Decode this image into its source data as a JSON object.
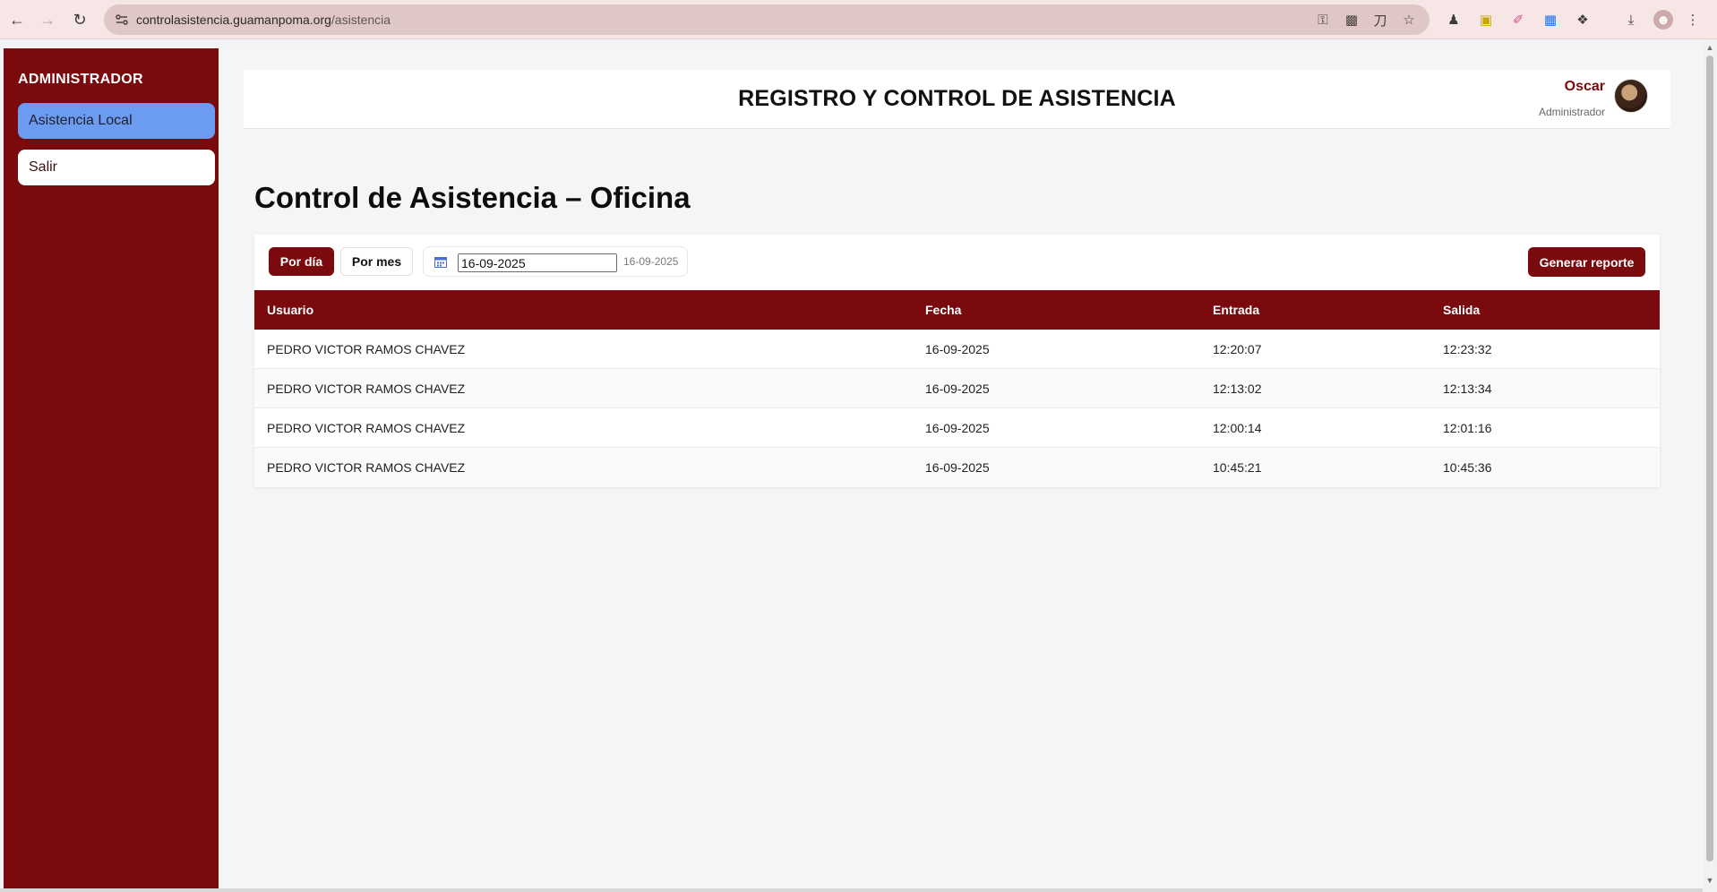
{
  "browser": {
    "url_domain": "controlasistencia.guamanpoma.org",
    "url_path": "/asistencia"
  },
  "sidebar": {
    "title": "ADMINISTRADOR",
    "items": [
      {
        "label": "Asistencia Local",
        "active": true
      },
      {
        "label": "Salir",
        "active": false
      }
    ]
  },
  "header": {
    "title": "REGISTRO Y CONTROL DE ASISTENCIA",
    "user_name": "Oscar",
    "user_role": "Administrador"
  },
  "page": {
    "title": "Control de Asistencia – Oficina"
  },
  "filters": {
    "day_label": "Por día",
    "month_label": "Por mes",
    "date_value": "16-09-2025",
    "date_hint": "16-09-2025",
    "report_label": "Generar reporte"
  },
  "table": {
    "headers": [
      "Usuario",
      "Fecha",
      "Entrada",
      "Salida"
    ],
    "rows": [
      {
        "usuario": "PEDRO VICTOR RAMOS CHAVEZ",
        "fecha": "16-09-2025",
        "entrada": "12:20:07",
        "salida": "12:23:32"
      },
      {
        "usuario": "PEDRO VICTOR RAMOS CHAVEZ",
        "fecha": "16-09-2025",
        "entrada": "12:13:02",
        "salida": "12:13:34"
      },
      {
        "usuario": "PEDRO VICTOR RAMOS CHAVEZ",
        "fecha": "16-09-2025",
        "entrada": "12:00:14",
        "salida": "12:01:16"
      },
      {
        "usuario": "PEDRO VICTOR RAMOS CHAVEZ",
        "fecha": "16-09-2025",
        "entrada": "10:45:21",
        "salida": "10:45:36"
      }
    ]
  },
  "colors": {
    "brand": "#7a0a0d",
    "active_nav": "#6b9cf2"
  },
  "icons": [
    "back-icon",
    "forward-icon",
    "reload-icon",
    "site-info-icon",
    "key-icon",
    "install-icon",
    "translate-icon",
    "star-icon",
    "extensions-icon",
    "downloads-icon",
    "profile-icon",
    "menu-icon",
    "calendar-icon"
  ]
}
